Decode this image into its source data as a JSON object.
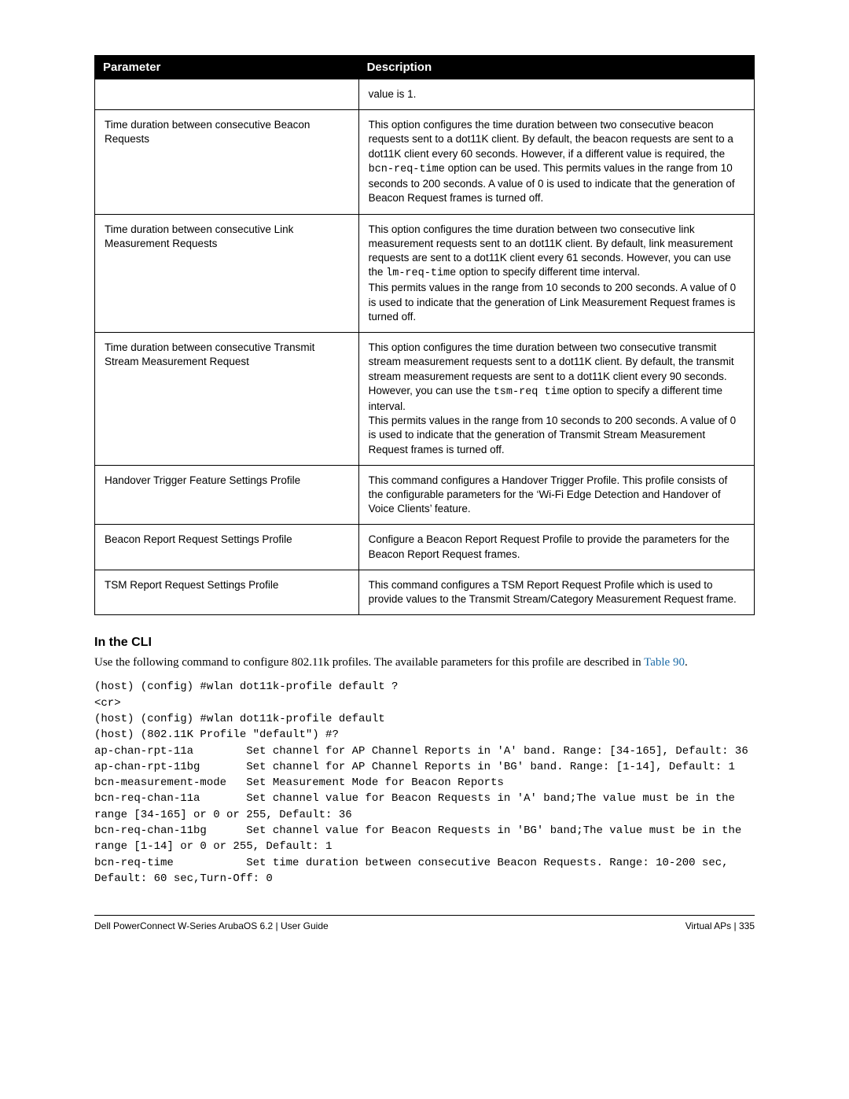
{
  "table": {
    "headers": {
      "param": "Parameter",
      "desc": "Description"
    },
    "rows": [
      {
        "param": "",
        "desc_html": "value is 1."
      },
      {
        "param": "Time duration between consecutive Beacon Requests",
        "desc_html": "This option configures the time duration between two consecutive beacon requests sent to a dot11K client. By default, the beacon requests are sent to a dot11K client every 60 seconds. However, if a different value is required, the <span class=\"mono\">bcn-req-time</span> option can be used. This permits values in the range from 10 seconds to 200 seconds. A value of 0 is used to indicate that the generation of Beacon Request frames is turned off."
      },
      {
        "param": "Time duration between consecutive Link Measurement Requests",
        "desc_html": "This option configures the time duration between two consecutive link measurement requests sent to an dot11K client. By default, link measurement requests are sent to a dot11K client every 61 seconds. However, you can use the <span class=\"mono\">lm-req-time</span> option to specify different time interval.<br>This permits values in the range from 10 seconds to 200 seconds. A value of 0 is used to indicate that the generation of Link Measurement Request frames is turned off."
      },
      {
        "param": "Time duration between consecutive Transmit Stream Measurement Request",
        "desc_html": "This option configures the time duration between two consecutive transmit stream measurement requests sent to a dot11K client. By default, the transmit stream measurement requests are sent to a dot11K client every 90 seconds. However, you can use the <span class=\"mono\">tsm-req time</span> option to specify a different time interval.<br>This permits values in the range from 10 seconds to 200 seconds. A value of 0 is used to indicate that the generation of Transmit Stream Measurement Request frames is turned off."
      },
      {
        "param": "Handover Trigger Feature Settings Profile",
        "desc_html": "This command configures a Handover Trigger Profile. This profile consists of the configurable parameters for the ‘Wi-Fi Edge Detection and Handover of Voice Clients’ feature."
      },
      {
        "param": "Beacon Report Request Settings Profile",
        "desc_html": "Configure a Beacon Report Request Profile to provide the parameters for the Beacon Report Request frames."
      },
      {
        "param": "TSM Report Request Settings Profile",
        "desc_html": "This command configures a TSM Report Request Profile which is used to provide values to the Transmit Stream/Category Measurement Request frame."
      }
    ]
  },
  "section": {
    "heading": "In the CLI",
    "intro_prefix": "Use the following command to configure 802.11k profiles. The available parameters for this profile are described in ",
    "link_text": "Table 90",
    "intro_suffix": "."
  },
  "cli": "(host) (config) #wlan dot11k-profile default ?\n<cr>\n(host) (config) #wlan dot11k-profile default\n(host) (802.11K Profile \"default\") #?\nap-chan-rpt-11a        Set channel for AP Channel Reports in 'A' band. Range: [34-165], Default: 36\nap-chan-rpt-11bg       Set channel for AP Channel Reports in 'BG' band. Range: [1-14], Default: 1\nbcn-measurement-mode   Set Measurement Mode for Beacon Reports\nbcn-req-chan-11a       Set channel value for Beacon Requests in 'A' band;The value must be in the range [34-165] or 0 or 255, Default: 36\nbcn-req-chan-11bg      Set channel value for Beacon Requests in 'BG' band;The value must be in the range [1-14] or 0 or 255, Default: 1\nbcn-req-time           Set time duration between consecutive Beacon Requests. Range: 10-200 sec, Default: 60 sec,Turn-Off: 0",
  "footer": {
    "left": "Dell PowerConnect W-Series ArubaOS 6.2  |  User Guide",
    "right": "Virtual APs | 335"
  }
}
